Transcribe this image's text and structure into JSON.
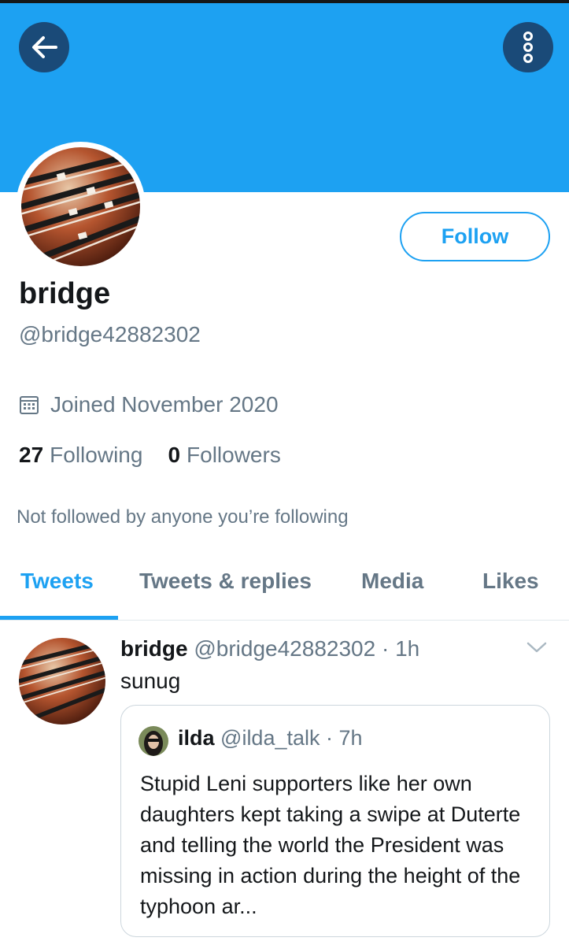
{
  "colors": {
    "accent": "#1da1f2",
    "banner": "#1da1f2",
    "nav_button_bg": "#1a4a78",
    "muted": "#657786"
  },
  "header": {
    "back_icon": "arrow-left-icon",
    "more_icon": "vertical-dots-icon"
  },
  "profile": {
    "display_name": "bridge",
    "handle": "@bridge42882302",
    "follow_label": "Follow",
    "joined": "Joined November 2020",
    "following_count": "27",
    "following_label": "Following",
    "followers_count": "0",
    "followers_label": "Followers",
    "not_followed_text": "Not followed by anyone you’re following"
  },
  "tabs": [
    {
      "label": "Tweets",
      "active": true
    },
    {
      "label": "Tweets & replies",
      "active": false
    },
    {
      "label": "Media",
      "active": false
    },
    {
      "label": "Likes",
      "active": false
    }
  ],
  "tweet": {
    "name": "bridge",
    "handle": "@bridge42882302",
    "time": "· 1h",
    "text": "sunug",
    "quote": {
      "name": "ilda",
      "handle": "@ilda_talk",
      "time": "· 7h",
      "text": "Stupid Leni supporters like her own daughters kept taking a swipe at Duterte and telling the world the President was missing in action during the height of the typhoon ar..."
    }
  }
}
